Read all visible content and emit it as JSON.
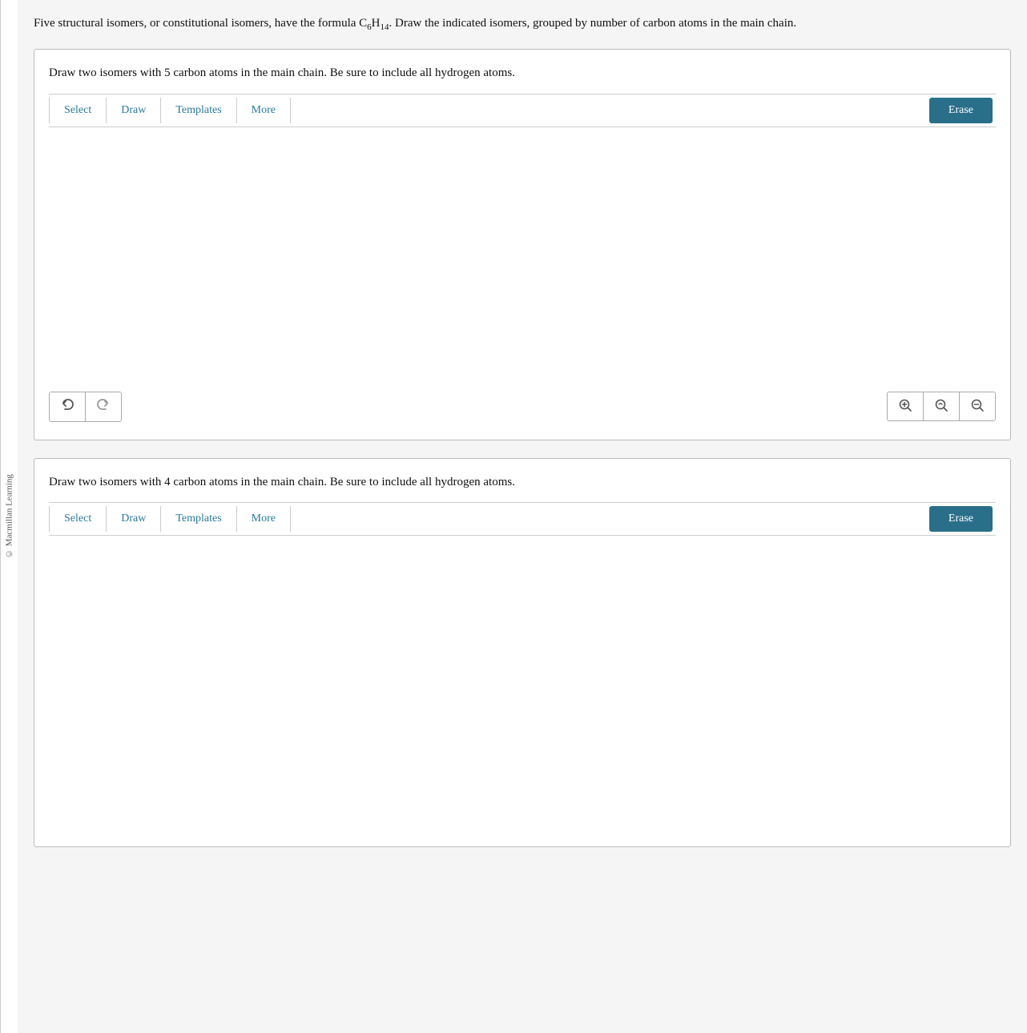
{
  "sidebar": {
    "label": "© Macmillan Learning"
  },
  "intro": {
    "text_before": "Five structural isomers, or constitutional isomers, have the formula C",
    "formula_c_sub": "6",
    "formula_h": "H",
    "formula_h_sub": "14",
    "text_after": ". Draw the indicated isomers, grouped by number of carbon atoms in the main chain."
  },
  "panel1": {
    "question": "Draw two isomers with 5 carbon atoms in the main chain. Be sure to include all hydrogen atoms.",
    "toolbar": {
      "select": "Select",
      "draw": "Draw",
      "templates": "Templates",
      "more": "More",
      "erase": "Erase"
    },
    "controls": {
      "undo": "↺",
      "redo": "↻",
      "zoom_in": "🔍",
      "zoom_reset": "⟲",
      "zoom_out": "🔍"
    }
  },
  "panel2": {
    "question": "Draw two isomers with 4 carbon atoms in the main chain. Be sure to include all hydrogen atoms.",
    "toolbar": {
      "select": "Select",
      "draw": "Draw",
      "templates": "Templates",
      "more": "More",
      "erase": "Erase"
    }
  }
}
